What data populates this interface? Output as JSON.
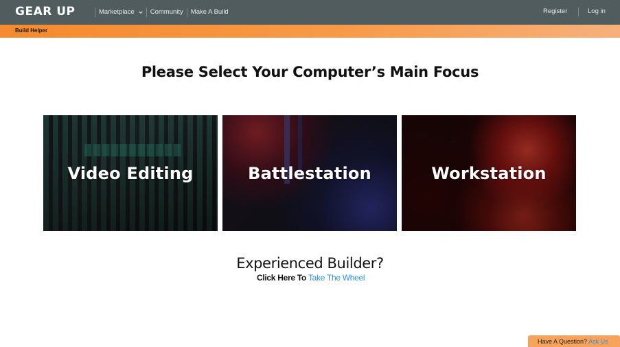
{
  "header": {
    "logo": "GEAR UP",
    "nav": [
      {
        "label": "Marketplace",
        "has_dropdown": true
      },
      {
        "label": "Community"
      },
      {
        "label": "Make A Build"
      }
    ],
    "register": "Register",
    "login": "Log in",
    "background_color": "#515c5e"
  },
  "subbar": {
    "label": "Build Helper",
    "color": "#f58a2e"
  },
  "main": {
    "title": "Please Select Your Computer’s Main Focus",
    "cards": [
      {
        "label": "Video Editing"
      },
      {
        "label": "Battlestation"
      },
      {
        "label": "Workstation"
      }
    ]
  },
  "experienced": {
    "title": "Experienced Builder?",
    "prefix": "Click Here To",
    "link": "Take The Wheel",
    "link_color": "#2e8fe0"
  },
  "help": {
    "question": "Have A Question?",
    "link": "Ask Us"
  }
}
